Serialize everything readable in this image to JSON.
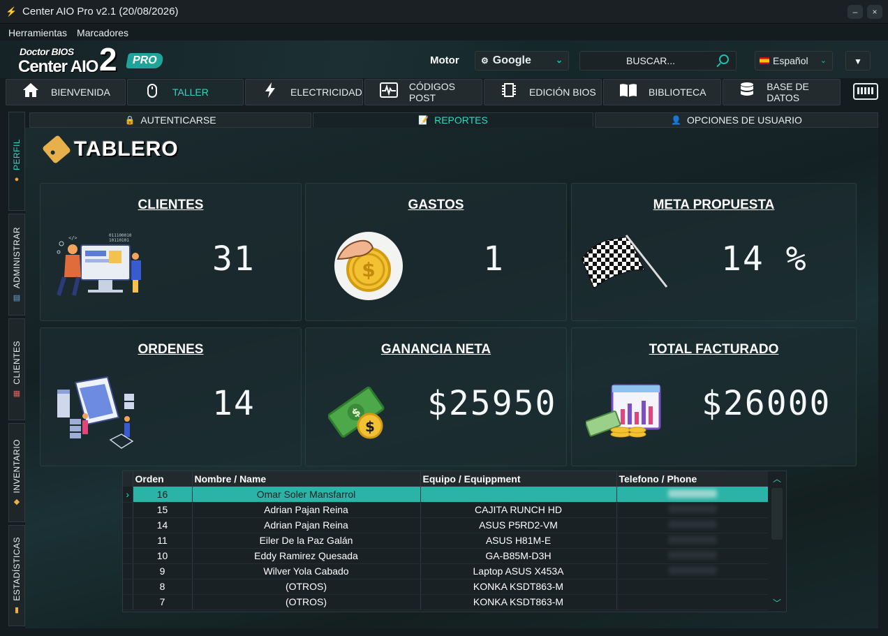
{
  "window": {
    "title": "Center AIO Pro v2.1 (20/08/2026)",
    "minimize": "–",
    "close": "×"
  },
  "menu": [
    {
      "label": "Herramientas"
    },
    {
      "label": "Marcadores"
    }
  ],
  "header": {
    "logo": {
      "line1": "Doctor BIOS",
      "line2": "Center AIO",
      "num": "2",
      "badge": "PRO"
    },
    "motor_label": "Motor",
    "engine": {
      "selected": "Google",
      "icon": "gear-icon"
    },
    "search": {
      "placeholder": "BUSCAR..."
    },
    "language": {
      "selected": "Español",
      "flag": "spain-flag"
    }
  },
  "nav": {
    "tabs": [
      {
        "label": "BIENVENIDA",
        "icon": "home-icon"
      },
      {
        "label": "TALLER",
        "icon": "mouse-icon",
        "active": true
      },
      {
        "label": "ELECTRICIDAD",
        "icon": "bolt-icon"
      },
      {
        "label": "CÓDIGOS POST",
        "icon": "pulse-icon"
      },
      {
        "label": "EDICIÓN BIOS",
        "icon": "chip-icon"
      },
      {
        "label": "BIBLIOTECA",
        "icon": "book-icon"
      },
      {
        "label": "BASE DE DATOS",
        "icon": "database-icon"
      }
    ]
  },
  "subtabs": [
    {
      "label": "AUTENTICARSE",
      "icon": "lock-icon"
    },
    {
      "label": "REPORTES",
      "icon": "report-icon",
      "active": true
    },
    {
      "label": "OPCIONES DE USUARIO",
      "icon": "user-options-icon"
    }
  ],
  "sidebar": [
    {
      "label": "PERFIL",
      "active": true
    },
    {
      "label": "ADMINISTRAR"
    },
    {
      "label": "CLIENTES"
    },
    {
      "label": "INVENTARIO"
    },
    {
      "label": "ESTADÍSTICAS"
    }
  ],
  "dashboard": {
    "title": "TABLERO",
    "cards": [
      {
        "title": "CLIENTES",
        "value": "31"
      },
      {
        "title": "GASTOS",
        "value": "1"
      },
      {
        "title": "META PROPUESTA",
        "value": "14 %"
      },
      {
        "title": "ORDENES",
        "value": "14"
      },
      {
        "title": "GANANCIA NETA",
        "value": "$25950"
      },
      {
        "title": "TOTAL FACTURADO",
        "value": "$26000"
      }
    ]
  },
  "table": {
    "columns": [
      "Orden",
      "Nombre / Name",
      "Equipo / Equippment",
      "Telefono / Phone"
    ],
    "rows": [
      {
        "orden": "16",
        "nombre": "Omar Soler Mansfarrol",
        "equipo": "",
        "phone_hidden": true
      },
      {
        "orden": "15",
        "nombre": "Adrian Pajan Reina",
        "equipo": "CAJITA RUNCH HD",
        "phone_hidden": true
      },
      {
        "orden": "14",
        "nombre": "Adrian Pajan Reina",
        "equipo": "ASUS P5RD2-VM",
        "phone_hidden": true
      },
      {
        "orden": "11",
        "nombre": "Eiler De la Paz Galán",
        "equipo": "ASUS H81M-E",
        "phone_hidden": true
      },
      {
        "orden": "10",
        "nombre": "Eddy Ramirez Quesada",
        "equipo": "GA-B85M-D3H",
        "phone_hidden": true
      },
      {
        "orden": "9",
        "nombre": "Wilver Yola Cabado",
        "equipo": "Laptop ASUS X453A",
        "phone_hidden": true
      },
      {
        "orden": "8",
        "nombre": "(OTROS)",
        "equipo": "KONKA KSDT863-M",
        "phone_hidden": false
      },
      {
        "orden": "7",
        "nombre": "(OTROS)",
        "equipo": "KONKA KSDT863-M",
        "phone_hidden": false
      }
    ],
    "selected_row": 0
  }
}
